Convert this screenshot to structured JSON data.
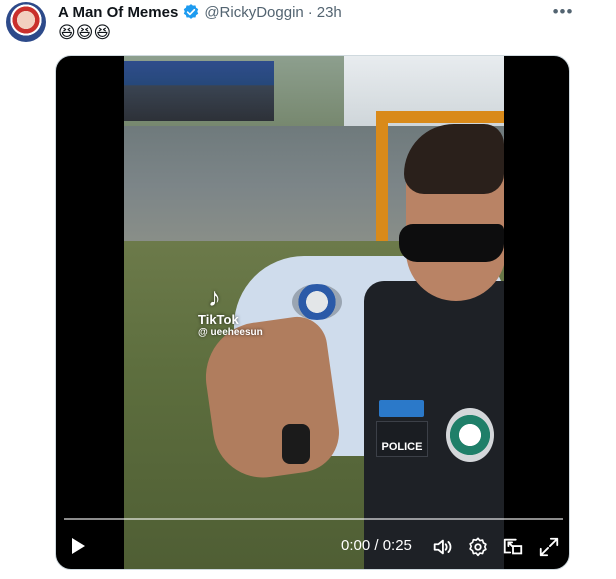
{
  "tweet": {
    "display_name": "A Man Of Memes",
    "handle": "@RickyDoggin",
    "separator": "·",
    "time": "23h",
    "text": "😆😆😆",
    "more_icon": "more-horizontal-icon",
    "verified_icon": "verified-badge-icon"
  },
  "video": {
    "watermark": {
      "logo_icon": "tiktok-icon",
      "brand": "TikTok",
      "user": "@ ueeheesun"
    },
    "police_label": "POLICE",
    "time_display": "0:00 / 0:25",
    "progress": 0.0,
    "controls": [
      "play-icon",
      "volume-icon",
      "settings-icon",
      "picture-in-picture-icon",
      "fullscreen-icon"
    ]
  },
  "colors": {
    "text": "#0f1419",
    "secondary": "#536471",
    "verified": "#1d9bf0",
    "media_background": "#000000"
  }
}
